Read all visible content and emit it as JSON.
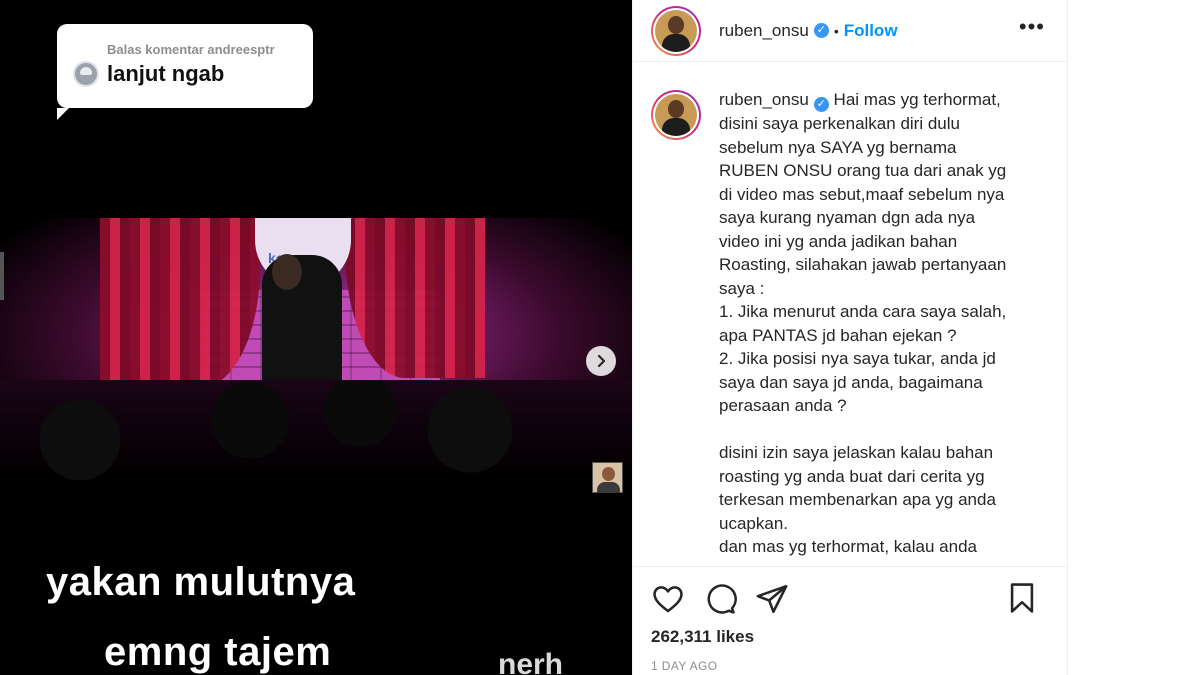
{
  "media": {
    "reply_header": "Balas komentar andreesptr",
    "reply_text": "lanjut ngab",
    "venue_logo_text": "ke...",
    "caption_line1": "yakan mulutnya",
    "caption_line2": "emng tajem",
    "corner_text": "nerh"
  },
  "post": {
    "username": "ruben_onsu",
    "separator": "•",
    "follow_label": "Follow",
    "more_label": "•••",
    "caption": "Hai mas yg terhormat,\ndisini saya perkenalkan diri dulu\nsebelum nya SAYA yg bernama\nRUBEN ONSU orang tua dari anak yg\ndi video mas sebut,maaf sebelum nya\nsaya kurang nyaman dgn ada nya\nvideo ini yg anda jadikan bahan\nRoasting, silahakan jawab pertanyaan\nsaya :\n1. Jika menurut anda cara saya salah,\napa PANTAS jd bahan ejekan ?\n2. Jika posisi nya saya tukar, anda jd\nsaya dan saya jd anda, bagaimana\nperasaan anda ?\n\ndisini izin saya jelaskan kalau bahan\nroasting yg anda buat dari cerita yg\nterkesan membenarkan apa yg anda\nucapkan.\ndan mas yg terhormat, kalau anda",
    "likes": "262,311 likes",
    "time_ago": "1 DAY AGO"
  },
  "icons": {
    "like": "heart-icon",
    "comment": "comment-icon",
    "share": "paper-plane-icon",
    "save": "bookmark-icon",
    "next": "chevron-right-icon",
    "verified": "verified-badge-icon"
  },
  "colors": {
    "follow_blue": "#0095f6",
    "verified_blue": "#3897f0",
    "muted_gray": "#8e8e8e",
    "text": "#262626"
  }
}
